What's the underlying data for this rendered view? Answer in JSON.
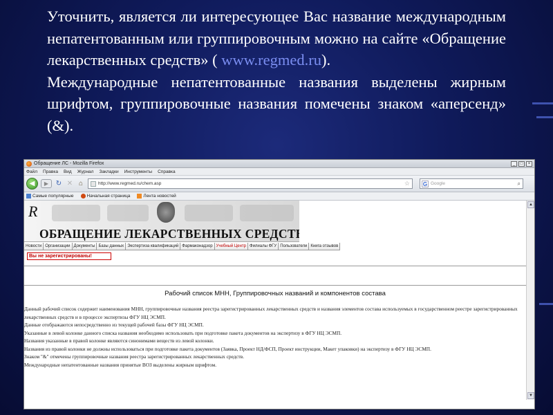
{
  "slide": {
    "p1_before_link": "Уточнить, является ли интересующее Вас название международным непатентованным или группировочным можно на сайте «Обращение лекарственных средств» ( ",
    "p1_link": "www.regmed.ru",
    "p1_after_link": ").",
    "p2": "Международные непатентованные названия выделены жирным шрифтом, группировочные названия помечены знаком «аперсенд» (&)."
  },
  "browser": {
    "window_title": "Обращение ЛС - Mozilla Firefox",
    "menu": [
      "Файл",
      "Правка",
      "Вид",
      "Журнал",
      "Закладки",
      "Инструменты",
      "Справка"
    ],
    "url": "http://www.regmed.ru/chem.asp",
    "search_placeholder": "Google",
    "bookmarks": [
      "Самые популярные",
      "Начальная страница",
      "Лента новостей"
    ]
  },
  "site": {
    "title": "ОБРАЩЕНИЕ ЛЕКАРСТВЕННЫХ СРЕДСТВ",
    "tabs": [
      "Новости",
      "Организации",
      "Документы",
      "Базы данных",
      "Экспертиза квалификаций",
      "Фармаконадзор",
      "Учебный Центр",
      "Филиалы ФГУ",
      "Пользователи",
      "Книга отзывов"
    ],
    "not_registered": "Вы не зарегистрированы!",
    "content_title": "Рабочий список МНН, Группировочных названий и компонентов состава",
    "content_lines": [
      "Данный рабочий список содержит наименования МНН, группировочные названия реестра зарегистрированных лекарственных средств и названия элементов состава используемых в государственном реестре зарегистрированных лекарственных средств и в процессе экспертизы ФГУ НЦ ЭСМП.",
      "Данные отображаются непосредственно из текущей рабочей базы ФГУ НЦ ЭСМП.",
      "Указанные в левой колонке данного списка названия необходимо использовать при подготовке пакета документов на экспертизу в ФГУ НЦ ЭСМП.",
      "Названия указанные в правой колонке являются синонимами веществ из левой колонки.",
      "Названия из правой колонки не должны использоваться при подготовке пакета документов (Заявка, Проект НД/ФСП, Проект инструкции, Макет упаковки) на экспертизу в ФГУ НЦ ЭСМП.",
      "Знаком \"&\" отмечены группировочные названия реестра зарегистрированных лекарственных средств.",
      "Международные непатентованные названия принятые ВОЗ выделены жирным шрифтом."
    ]
  }
}
